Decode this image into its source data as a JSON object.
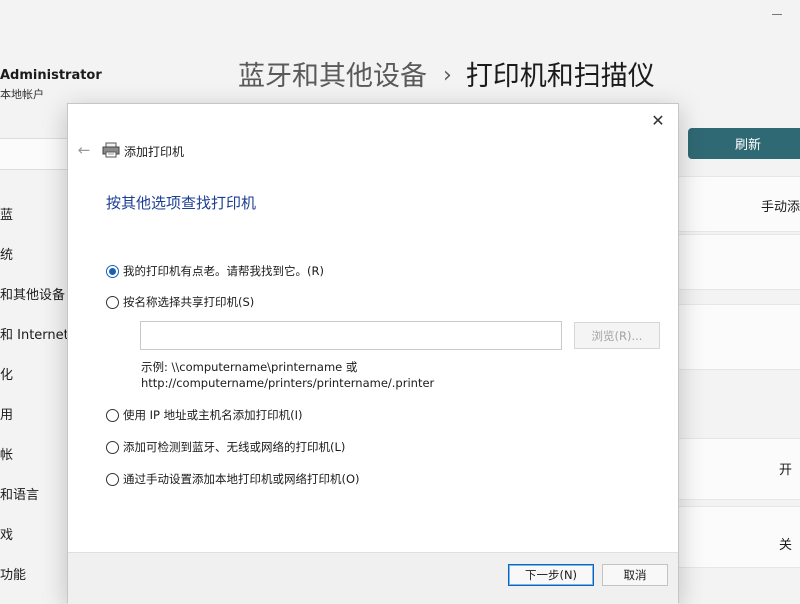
{
  "settings": {
    "user": {
      "name": "Administrator",
      "account_type": "本地帐户"
    },
    "nav": {
      "items": [
        {
          "label": "蓝"
        },
        {
          "label": "统"
        },
        {
          "label": "和其他设备"
        },
        {
          "label": "和 Internet"
        },
        {
          "label": "化"
        },
        {
          "label": "用"
        },
        {
          "label": "帐"
        },
        {
          "label": "和语言"
        },
        {
          "label": "戏"
        },
        {
          "label": "功能"
        }
      ]
    },
    "breadcrumb": {
      "parent": "蓝牙和其他设备",
      "separator": "›",
      "current": "打印机和扫描仪"
    },
    "refresh_label": "刷新",
    "manual_add_label": "手动添",
    "toggle_on_label": "开",
    "toggle_off_label": "关"
  },
  "dialog": {
    "title": "添加打印机",
    "heading": "按其他选项查找打印机",
    "options": [
      {
        "label": "我的打印机有点老。请帮我找到它。(R)",
        "checked": true
      },
      {
        "label": "按名称选择共享打印机(S)",
        "checked": false
      },
      {
        "label": "使用 IP 地址或主机名添加打印机(I)",
        "checked": false
      },
      {
        "label": "添加可检测到蓝牙、无线或网络的打印机(L)",
        "checked": false
      },
      {
        "label": "通过手动设置添加本地打印机或网络打印机(O)",
        "checked": false
      }
    ],
    "name_input": {
      "value": "",
      "placeholder": ""
    },
    "browse_label": "浏览(R)...",
    "example_line1": "示例: \\\\computername\\printername 或",
    "example_line2": "http://computername/printers/printername/.printer",
    "next_label": "下一步(N)",
    "cancel_label": "取消"
  },
  "colors": {
    "accent": "#2f6974",
    "heading": "#1c3f94",
    "radio_selected": "#1a5fb4"
  }
}
